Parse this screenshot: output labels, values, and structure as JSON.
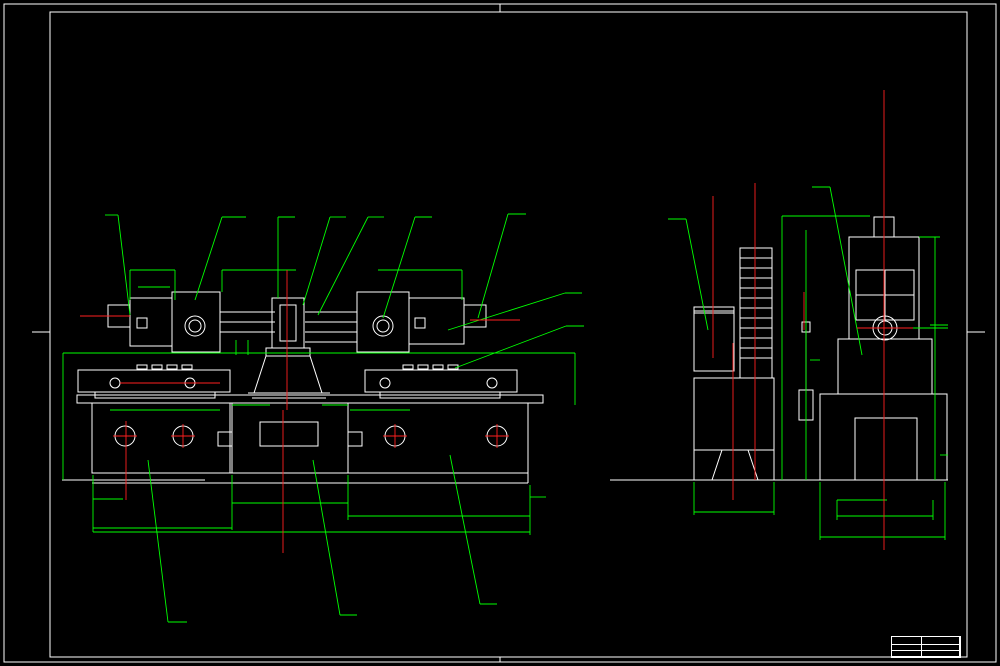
{
  "drawing": {
    "line_color": "#ffffff",
    "dimension_color": "#00ff00",
    "centerline_color": "#ff2020",
    "background": "#000000"
  },
  "leaders_front": [
    "",
    "",
    "",
    "",
    "",
    "",
    "",
    "",
    ""
  ],
  "leaders_side": [
    "",
    ""
  ],
  "leaders_bottom": [
    "",
    "",
    ""
  ],
  "title_block": {
    "title": "",
    "rows": [
      "",
      "",
      ""
    ]
  }
}
